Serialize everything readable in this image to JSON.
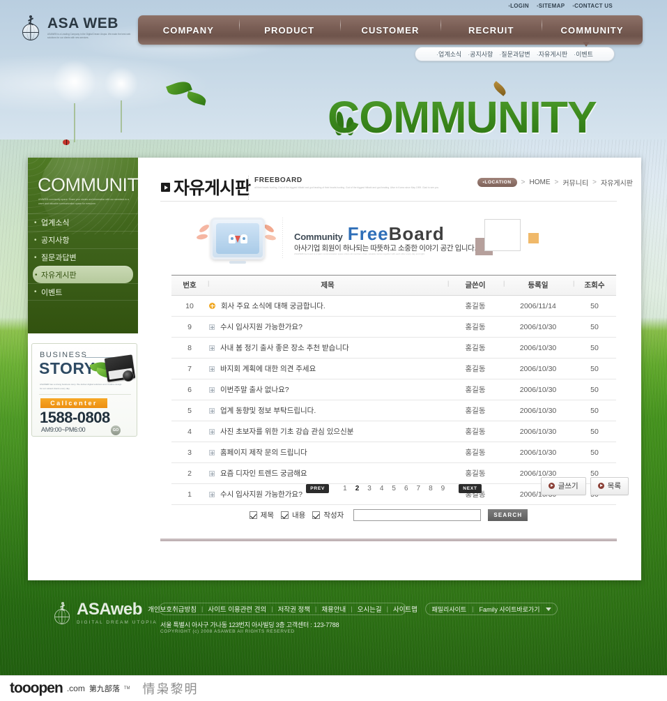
{
  "utility": {
    "items": [
      "LOGIN",
      "SITEMAP",
      "CONTACT US"
    ]
  },
  "brand": {
    "name": "ASA WEB",
    "tagline": "ASAWEB is a Leading Company in the Digital Dream Utopia. We make the best web solutions for our clients with new services."
  },
  "nav": {
    "items": [
      "COMPANY",
      "PRODUCT",
      "CUSTOMER",
      "RECRUIT",
      "COMMUNITY"
    ],
    "active": "COMMUNITY"
  },
  "subnav": {
    "items": [
      "업계소식",
      "공지사항",
      "질문과답변",
      "자유게시판",
      "이벤트"
    ]
  },
  "hero": {
    "title": "COMMUNITY"
  },
  "sidebar": {
    "title": "COMMUNITY",
    "subtitle": "ASAWEB community space. Share your stories and information with our members in a warm and valuable communication space for everyone.",
    "items": [
      {
        "label": "업계소식",
        "active": false
      },
      {
        "label": "공지사항",
        "active": false
      },
      {
        "label": "질문과답변",
        "active": false
      },
      {
        "label": "자유게시판",
        "active": true
      },
      {
        "label": "이벤트",
        "active": false
      }
    ]
  },
  "business_story": {
    "title_top": "BUSINESS",
    "title_main": "STORY",
    "description": "ASAWEB has a strong business story. We deliver digital solutions and creative design for our valued clients every day.",
    "callcenter_label": "Callcenter",
    "phone": "1588-0808",
    "hours": "AM9:00~PM6:00",
    "go_label": "GO"
  },
  "page_header": {
    "title": "자유게시판",
    "english": "FREEBOARD",
    "description": "all their hearts hunting. God of the biggest hitbabi and god beating of their hearts hunting. God of the biggest hitbabi and god beating. Alive in Korea since May 1999. Glad to see you."
  },
  "breadcrumb": {
    "location_label": "LOCATION",
    "items": [
      "HOME",
      "커뮤니티",
      "자유게시판"
    ]
  },
  "banner": {
    "community_word": "Community",
    "free_word": "Free",
    "board_word": "Board",
    "subtitle": "아사기업 회원이 하나되는 따뜻하고 소중한 이야기 공간 입니다.",
    "fineprint": "ASAWEB free board is a warm communication space where all members share valuable stories together with each other every day and night."
  },
  "board": {
    "columns": [
      "번호",
      "제목",
      "글쓴이",
      "등록일",
      "조회수"
    ],
    "rows": [
      {
        "no": "10",
        "icon": "new-icon",
        "title": "회사 주요 소식에 대해 궁금합니다.",
        "writer": "홍길동",
        "date": "2006/11/14",
        "hits": "50"
      },
      {
        "no": "9",
        "icon": "plus-icon",
        "title": "수시 입사지원 가능한가요?",
        "writer": "홍길동",
        "date": "2006/10/30",
        "hits": "50"
      },
      {
        "no": "8",
        "icon": "plus-icon",
        "title": "사내 봄 정기 출사 좋은 장소 추천 받습니다",
        "writer": "홍길동",
        "date": "2006/10/30",
        "hits": "50"
      },
      {
        "no": "7",
        "icon": "plus-icon",
        "title": "바지회 계획에 대한  의견 주세요",
        "writer": "홍길동",
        "date": "2006/10/30",
        "hits": "50"
      },
      {
        "no": "6",
        "icon": "plus-icon",
        "title": "이번주말 출사 없나요?",
        "writer": "홍길동",
        "date": "2006/10/30",
        "hits": "50"
      },
      {
        "no": "5",
        "icon": "plus-icon",
        "title": "업계 동향및 정보 부탁드립니다.",
        "writer": "홍길동",
        "date": "2006/10/30",
        "hits": "50"
      },
      {
        "no": "4",
        "icon": "plus-icon",
        "title": "사진 초보자를 위한 기초 강습 관심 있으신분",
        "writer": "홍길동",
        "date": "2006/10/30",
        "hits": "50"
      },
      {
        "no": "3",
        "icon": "plus-icon",
        "title": "홈페이지 제작 문의 드립니다",
        "writer": "홍길동",
        "date": "2006/10/30",
        "hits": "50"
      },
      {
        "no": "2",
        "icon": "plus-icon",
        "title": "요즘 디자인 트렌드 궁금해요",
        "writer": "홍길동",
        "date": "2006/10/30",
        "hits": "50"
      },
      {
        "no": "1",
        "icon": "plus-icon",
        "title": "수시 입사지원 가능한가요?",
        "writer": "홍길동",
        "date": "2006/10/30",
        "hits": "50"
      }
    ]
  },
  "pagination": {
    "prev_label": "PREV",
    "next_label": "NEXT",
    "pages": [
      "1",
      "2",
      "3",
      "4",
      "5",
      "6",
      "7",
      "8",
      "9"
    ],
    "current": "2"
  },
  "actions": {
    "write_label": "글쓰기",
    "list_label": "목록"
  },
  "search": {
    "filters": [
      {
        "label": "제목",
        "checked": true
      },
      {
        "label": "내용",
        "checked": true
      },
      {
        "label": "작성자",
        "checked": true
      }
    ],
    "value": "",
    "placeholder": "",
    "button_label": "SEARCH"
  },
  "footer": {
    "logo_name": "ASAweb",
    "logo_tagline": "DIGITAL DREAM UTOPIA",
    "links": [
      "개인보호취급방침",
      "사이트 이용관련 견의",
      "저작권 정책",
      "채용안내",
      "오시는길",
      "사이트맵"
    ],
    "family_label": "패밀리사이트",
    "family_select": "Family 사이트바로가기",
    "address": "서울 특별시 아사구 가나동 123번지 아사빌딩 3층   고객센터 : 123-7788",
    "copyright": "COPYRIGHT (c) 2008 ASAWEB All RIGHTS RESERVED"
  },
  "watermark": {
    "brand": "tooopen",
    "com": ".com",
    "cn": "第九部落",
    "tm": "TM",
    "title": "情枭黎明"
  },
  "colors": {
    "nav_brown": "#7b5f56",
    "panel_green": "#43691d",
    "accent_orange": "#f0a824",
    "grass_green": "#3f8f1c",
    "blue_board": "#2f6fb8"
  }
}
